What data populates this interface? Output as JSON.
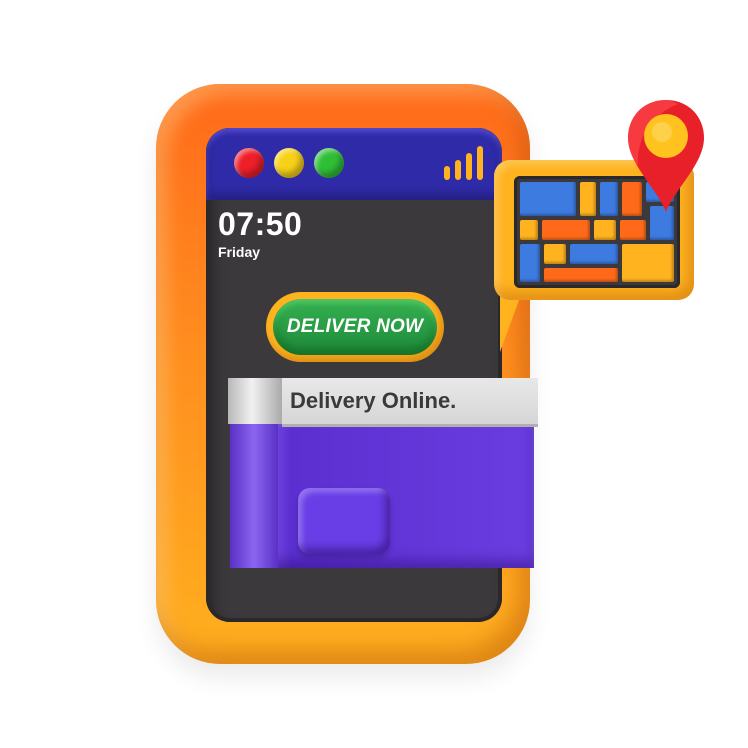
{
  "window": {
    "controls": [
      "close-dot",
      "minimize-dot",
      "maximize-dot"
    ],
    "signal_icon": "signal-bars-icon"
  },
  "status": {
    "time": "07:50",
    "day": "Friday"
  },
  "actions": {
    "deliver_label": "DELIVER NOW"
  },
  "banner": {
    "text": "Delivery Online."
  },
  "map": {
    "icon": "map-icon",
    "pin_icon": "location-pin-icon"
  },
  "colors": {
    "frame": "#ff8d1f",
    "topbar": "#2f2aa8",
    "button": "#1e8a3a",
    "box": "#6a3de0",
    "pin": "#e8202a"
  }
}
